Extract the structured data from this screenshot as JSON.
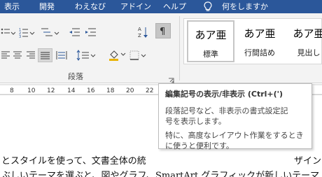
{
  "tabs": [
    {
      "label": "表示"
    },
    {
      "label": "開発"
    },
    {
      "label": "わえなび"
    },
    {
      "label": "アドイン"
    },
    {
      "label": "ヘルプ"
    }
  ],
  "tell_me": {
    "label": "何をしますか",
    "icon": "lightbulb-icon"
  },
  "paragraph_group": {
    "label": "段落",
    "buttons": [
      "bullets",
      "numbering",
      "multilevel-list",
      "decrease-indent",
      "increase-indent",
      "sort",
      "show-hide-marks",
      "align-left",
      "center",
      "align-right",
      "justify",
      "distributed",
      "line-spacing",
      "shading",
      "borders"
    ]
  },
  "styles": [
    {
      "sample": "あア亜",
      "name": "標準",
      "selected": true
    },
    {
      "sample": "あア亜",
      "name": "行間詰め",
      "selected": false
    },
    {
      "sample": "あア亜",
      "name": "見出し",
      "selected": false
    }
  ],
  "ruler": {
    "ticks": [
      "8",
      "10",
      "12",
      "14",
      "16",
      "18",
      "20",
      "22",
      "24"
    ]
  },
  "tooltip": {
    "title": "編集記号の表示/非表示 (Ctrl+(')",
    "lines": [
      "段落記号など、非表示の書式設定記",
      "号を表示します。",
      "",
      "特に、高度なレイアウト作業をするとき",
      "に使うと便利です。"
    ]
  },
  "document": {
    "lines": [
      "とスタイルを使って、文書全体の統",
      "ザイン",
      "ぶしいテーマを選ぶと、図やグラフ、SmartArt グラフィックが新しいテーマ"
    ]
  },
  "colors": {
    "tab_bar": "#2b579a",
    "ribbon": "#f3f3f3",
    "shading_accent": "#e8b200"
  }
}
